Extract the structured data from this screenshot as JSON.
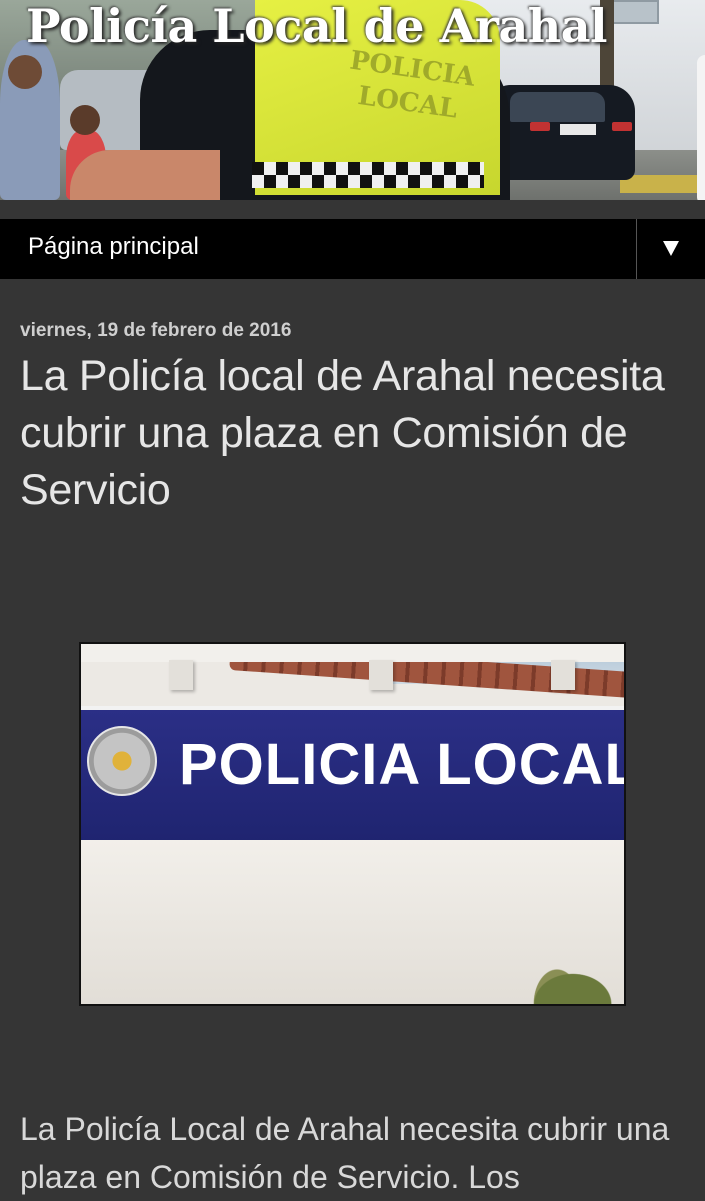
{
  "header": {
    "blog_title": "Policía Local de Arahal",
    "banner_vest_text": "POLICIA LOCAL"
  },
  "nav": {
    "current_page": "Página principal",
    "toggle_icon": "dropdown-arrow"
  },
  "post": {
    "date": "viernes, 19 de febrero de 2016",
    "title": "La Policía local de Arahal necesita cubrir una plaza en Comisión de Servicio",
    "image_sign_text": "POLICIA LOCAL",
    "body_text": "La Policía Local de Arahal necesita cubrir una plaza en Comisión de Servicio. Los"
  },
  "colors": {
    "page_background": "#353535",
    "nav_background": "#000000",
    "title_text": "#e6e6e6",
    "sign_blue": "#2b2f86"
  }
}
